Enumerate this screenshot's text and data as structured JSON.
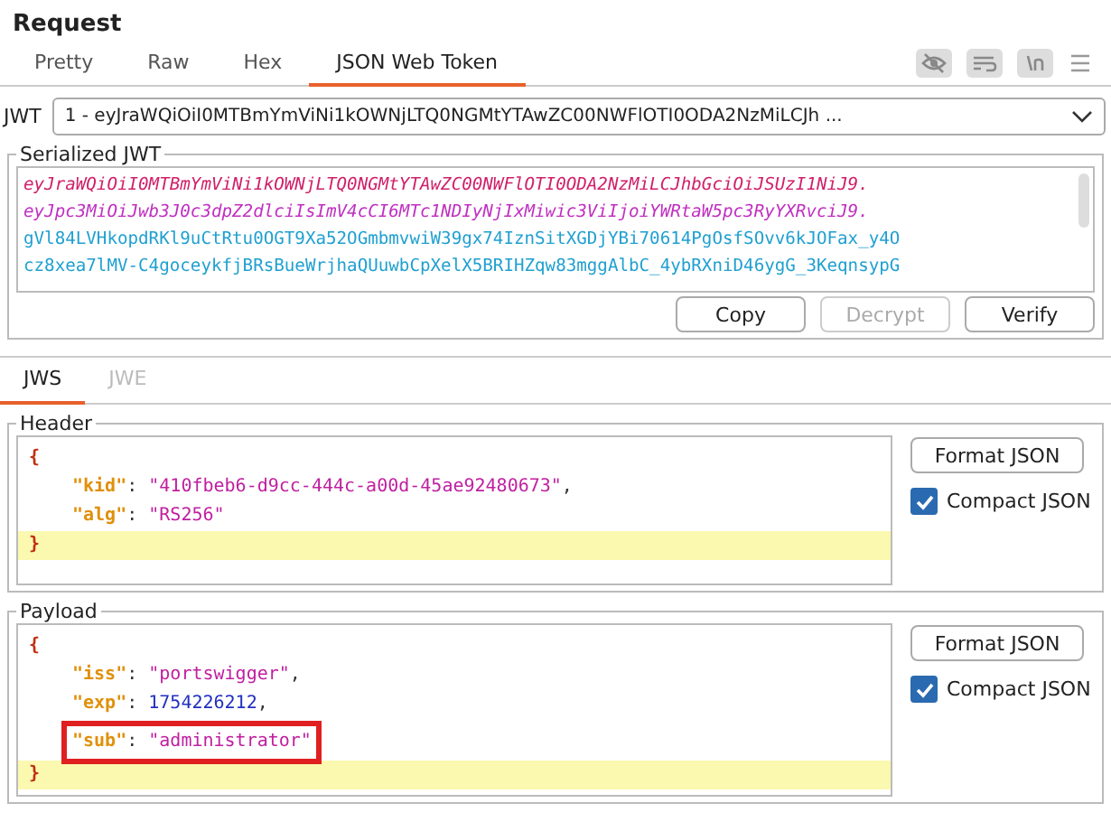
{
  "title": "Request",
  "tabs": [
    {
      "label": "Pretty",
      "selected": false
    },
    {
      "label": "Raw",
      "selected": false
    },
    {
      "label": "Hex",
      "selected": false
    },
    {
      "label": "JSON Web Token",
      "selected": true
    }
  ],
  "jwt_select": {
    "label": "JWT",
    "value": "1 - eyJraWQiOiI0MTBmYmViNi1kOWNjLTQ0NGMtYTAwZC00NWFlOTI0ODA2NzMiLCJh ..."
  },
  "serialized": {
    "legend": "Serialized JWT",
    "lines": [
      {
        "kind": "header",
        "text": "eyJraWQiOiI0MTBmYmViNi1kOWNjLTQ0NGMtYTAwZC00NWFlOTI0ODA2NzMiLCJhbGciOiJSUzI1NiJ9."
      },
      {
        "kind": "payload",
        "text": "eyJpc3MiOiJwb3J0c3dpZ2dlciIsImV4cCI6MTc1NDIyNjIxMiwic3ViIjoiYWRtaW5pc3RyYXRvciJ9."
      },
      {
        "kind": "signature",
        "text": "gVl84LVHkopdRKl9uCtRtu0OGT9Xa52OGmbmvwiW39gx74IznSitXGDjYBi70614PgOsfSOvv6kJOFax_y4O"
      },
      {
        "kind": "signature",
        "text": "cz8xea7lMV-C4goceykfjBRsBueWrjhaQUuwbCpXelX5BRIHZqw83mggAlbC_4ybRXniD46ygG_3KeqnsypG"
      }
    ],
    "buttons": [
      {
        "label": "Copy",
        "disabled": false
      },
      {
        "label": "Decrypt",
        "disabled": true
      },
      {
        "label": "Verify",
        "disabled": false
      }
    ]
  },
  "sub_tabs": [
    {
      "label": "JWS",
      "selected": true,
      "disabled": false
    },
    {
      "label": "JWE",
      "selected": false,
      "disabled": true
    }
  ],
  "sections": [
    {
      "legend": "Header",
      "open": "{",
      "close": "}",
      "entries": [
        {
          "key": "\"kid\"",
          "colon": ":",
          "value": "\"410fbeb6-d9cc-444c-a00d-45ae92480673\"",
          "kind": "string",
          "comma": ","
        },
        {
          "key": "\"alg\"",
          "colon": ":",
          "value": "\"RS256\"",
          "kind": "string"
        }
      ],
      "format_button": "Format JSON",
      "compact": {
        "label": "Compact JSON",
        "checked": true
      }
    },
    {
      "legend": "Payload",
      "open": "{",
      "close": "}",
      "entries": [
        {
          "key": "\"iss\"",
          "colon": ":",
          "value": "\"portswigger\"",
          "kind": "string",
          "comma": ","
        },
        {
          "key": "\"exp\"",
          "colon": ":",
          "value": "1754226212",
          "kind": "number",
          "comma": ","
        },
        {
          "key": "\"sub\"",
          "colon": ":",
          "value": "\"administrator\"",
          "kind": "string",
          "highlighted": true
        }
      ],
      "format_button": "Format JSON",
      "compact": {
        "label": "Compact JSON",
        "checked": true
      }
    }
  ]
}
